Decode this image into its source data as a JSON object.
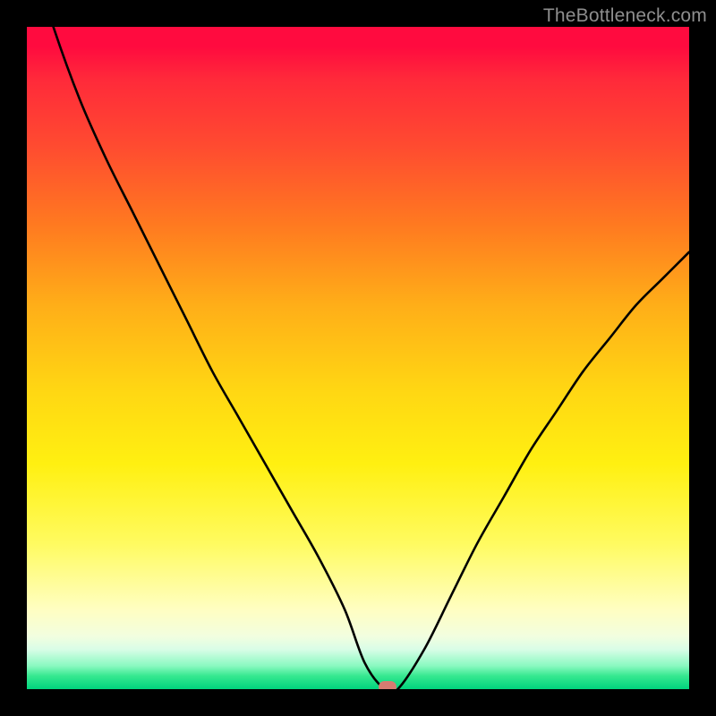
{
  "watermark": "TheBottleneck.com",
  "marker": {
    "color": "#d77c71"
  },
  "chart_data": {
    "type": "line",
    "title": "",
    "xlabel": "",
    "ylabel": "",
    "xlim": [
      0,
      100
    ],
    "ylim": [
      0,
      100
    ],
    "series": [
      {
        "name": "bottleneck-curve",
        "x": [
          0,
          4,
          8,
          12,
          16,
          20,
          24,
          28,
          32,
          36,
          40,
          44,
          48,
          51,
          54,
          56,
          60,
          64,
          68,
          72,
          76,
          80,
          84,
          88,
          92,
          96,
          100
        ],
        "y": [
          113,
          100,
          89,
          80,
          72,
          64,
          56,
          48,
          41,
          34,
          27,
          20,
          12,
          4,
          0,
          0,
          6,
          14,
          22,
          29,
          36,
          42,
          48,
          53,
          58,
          62,
          66
        ]
      }
    ],
    "marker_point": {
      "x": 54.5,
      "y": 0
    },
    "annotations": []
  }
}
